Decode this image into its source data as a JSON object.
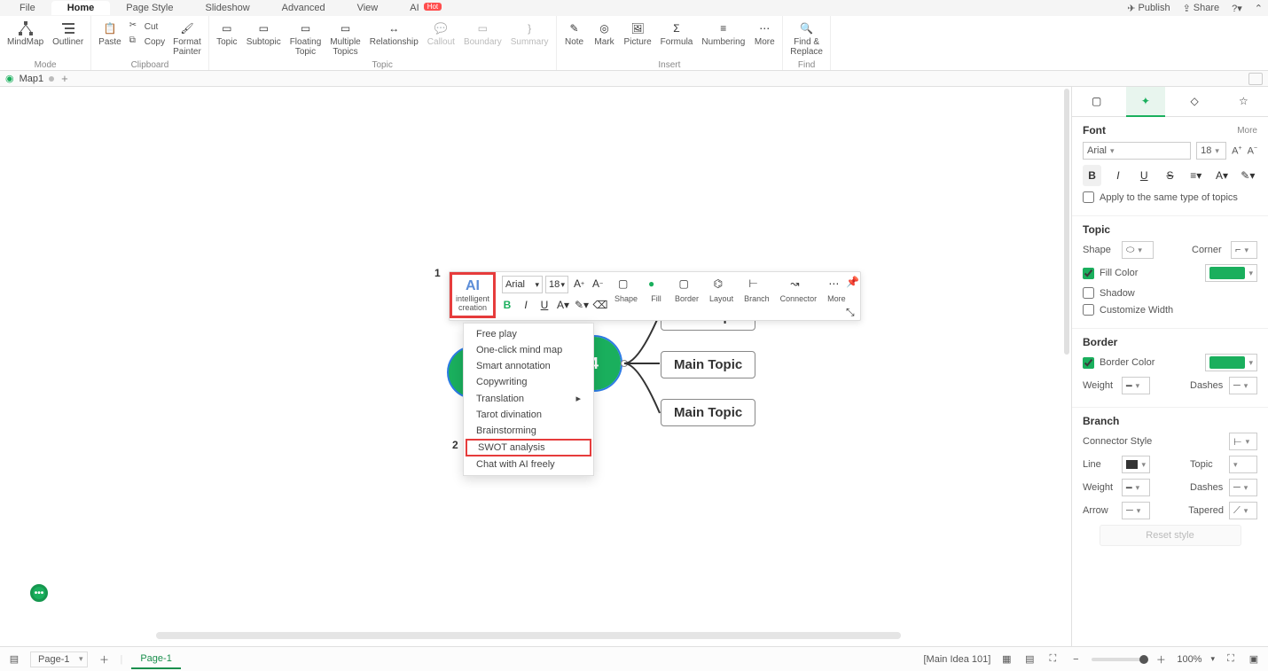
{
  "menubar": {
    "tabs": [
      "File",
      "Home",
      "Page Style",
      "Slideshow",
      "Advanced",
      "View"
    ],
    "active_index": 1,
    "ai_label": "AI",
    "ai_badge": "Hot",
    "right": {
      "publish": "Publish",
      "share": "Share"
    }
  },
  "ribbon": {
    "mode": {
      "mindmap": "MindMap",
      "outliner": "Outliner",
      "group": "Mode"
    },
    "clipboard": {
      "paste": "Paste",
      "cut": "Cut",
      "copy": "Copy",
      "format_painter": "Format\nPainter",
      "group": "Clipboard"
    },
    "topic": {
      "topic": "Topic",
      "subtopic": "Subtopic",
      "floating": "Floating\nTopic",
      "multiple": "Multiple\nTopics",
      "relationship": "Relationship",
      "callout": "Callout",
      "boundary": "Boundary",
      "summary": "Summary",
      "group": "Topic"
    },
    "insert": {
      "note": "Note",
      "mark": "Mark",
      "picture": "Picture",
      "formula": "Formula",
      "numbering": "Numbering",
      "more": "More",
      "group": "Insert"
    },
    "find": {
      "label": "Find &\nReplace",
      "group": "Find"
    }
  },
  "doctabs": {
    "name": "Map1",
    "plus": "+"
  },
  "canvas": {
    "num1": "1",
    "num2": "2",
    "central_text": "4",
    "main_topic": "Main Topic"
  },
  "float_toolbar": {
    "ai_title": "AI",
    "ai_sub": "intelligent\ncreation",
    "font": "Arial",
    "size": "18",
    "tools": {
      "shape": "Shape",
      "fill": "Fill",
      "border": "Border",
      "layout": "Layout",
      "branch": "Branch",
      "connector": "Connector",
      "more": "More"
    }
  },
  "ai_menu": {
    "items": [
      "Free play",
      "One-click mind map",
      "Smart annotation",
      "Copywriting",
      "Translation",
      "Tarot divination",
      "Brainstorming",
      "SWOT analysis",
      "Chat with AI freely"
    ],
    "highlight_index": 7,
    "submenu_index": 4
  },
  "sidepanel": {
    "font": {
      "title": "Font",
      "more": "More",
      "family": "Arial",
      "size": "18",
      "apply_same": "Apply to the same type of topics"
    },
    "topic": {
      "title": "Topic",
      "shape": "Shape",
      "corner": "Corner",
      "fill_color": "Fill Color",
      "fill_color_value": "#1aaf5d",
      "shadow": "Shadow",
      "custom_width": "Customize Width"
    },
    "border": {
      "title": "Border",
      "border_color": "Border Color",
      "border_color_value": "#1aaf5d",
      "weight": "Weight",
      "dashes": "Dashes"
    },
    "branch": {
      "title": "Branch",
      "connector_style": "Connector Style",
      "line": "Line",
      "topic": "Topic",
      "weight": "Weight",
      "dashes": "Dashes",
      "arrow": "Arrow",
      "tapered": "Tapered"
    },
    "reset": "Reset style"
  },
  "statusbar": {
    "page_select": "Page-1",
    "page_tab": "Page-1",
    "selection": "[Main Idea 101]",
    "zoom": "100%"
  }
}
